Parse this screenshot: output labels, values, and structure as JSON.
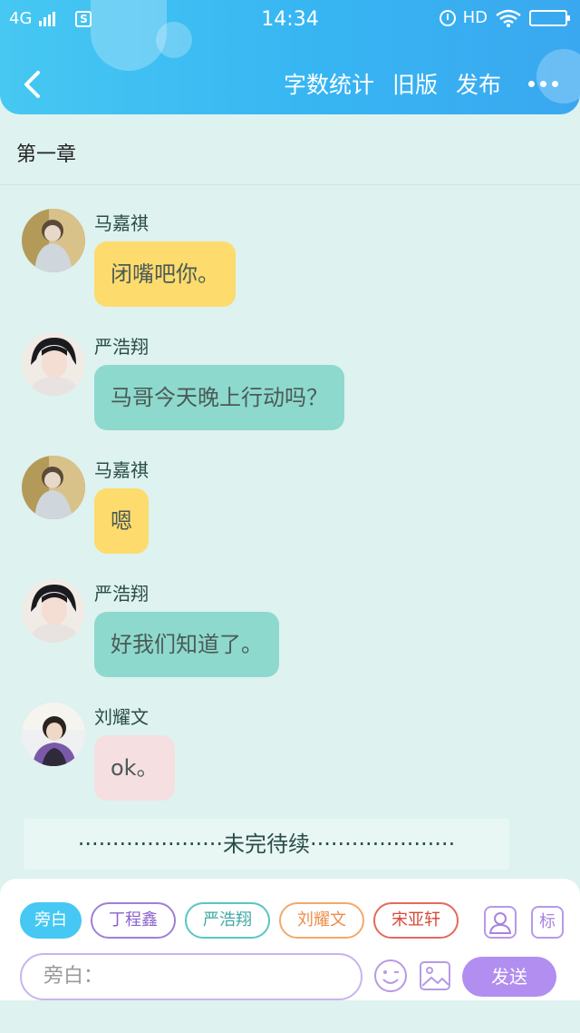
{
  "status_bar": {
    "network": "4G",
    "time": "14:34",
    "hd": "HD"
  },
  "nav": {
    "word_count": "字数统计",
    "old_version": "旧版",
    "publish": "发布"
  },
  "chapter_title": "第一章",
  "messages": [
    {
      "name": "马嘉祺",
      "text": "闭嘴吧你。",
      "color": "#fddb6d"
    },
    {
      "name": "严浩翔",
      "text": "马哥今天晚上行动吗？",
      "color": "#8ed9cd"
    },
    {
      "name": "马嘉祺",
      "text": "嗯",
      "color": "#fddb6d"
    },
    {
      "name": "严浩翔",
      "text": "好我们知道了。",
      "color": "#8ed9cd"
    },
    {
      "name": "刘耀文",
      "text": "ok。",
      "color": "#f6dfe0"
    }
  ],
  "to_be_continued": "·····················未完待续·····················",
  "composer": {
    "roles": [
      "旁白",
      "丁程鑫",
      "严浩翔",
      "刘耀文",
      "宋亚轩"
    ],
    "tag_label": "标",
    "input_placeholder": "旁白：",
    "send_label": "发送"
  },
  "colors": {
    "header": "#37b5f2",
    "background": "#def2ef",
    "send": "#b18ef0"
  }
}
